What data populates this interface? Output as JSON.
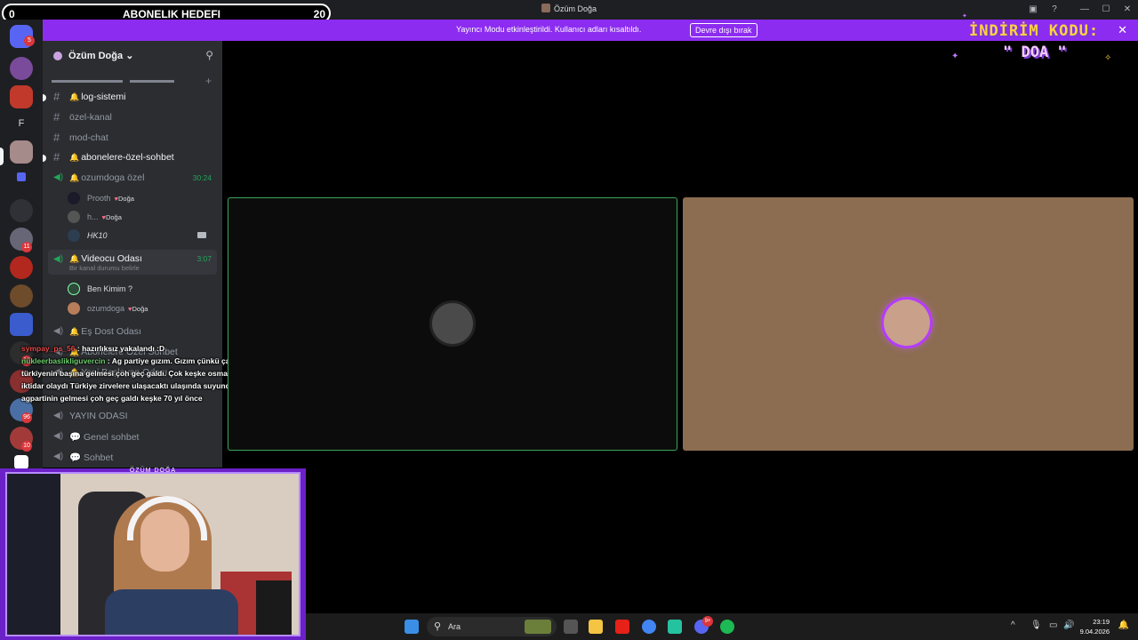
{
  "window": {
    "title": "Özüm Doğa",
    "controls": [
      "—",
      "☐",
      "✕"
    ]
  },
  "subscriber_goal": {
    "current": "0",
    "label": "ABONELIK HEDEFI",
    "target": "20"
  },
  "streamer_banner": {
    "message": "Yayıncı Modu etkinleştirildi. Kullanıcı adları kısaltıldı.",
    "button": "Devre dışı bırak",
    "close": "✕"
  },
  "server_rail": {
    "badges": [
      "5",
      "11",
      "17",
      "96",
      "10"
    ],
    "letter_server": "F"
  },
  "server": {
    "name": "Özüm Doğa",
    "chevron": "⌄",
    "invite_icon": "user-plus-icon"
  },
  "channels": [
    {
      "type": "text",
      "name": "log-sistemi",
      "bell": true
    },
    {
      "type": "text",
      "name": "özel-kanal",
      "bell": false
    },
    {
      "type": "text",
      "name": "mod-chat",
      "bell": false
    },
    {
      "type": "text",
      "name": "abonelere-özel-sohbet",
      "bell": true
    },
    {
      "type": "voice",
      "name": "ozumdoga özel",
      "bell": true,
      "time": "30:24"
    },
    {
      "type": "voice",
      "name": "Videocu Odası",
      "bell": true,
      "time": "3:07",
      "status": "Bir kanal durumu belirle"
    },
    {
      "type": "voice",
      "name": "Eş Dost Odası",
      "bell": true
    },
    {
      "type": "voice",
      "name": "Abonelere Özel Sohbet",
      "bell": true
    },
    {
      "type": "voice",
      "name": "Yeni Başlayan Odası",
      "bell": true
    },
    {
      "type": "voice",
      "name": "YAYIN ODASI",
      "bell": false
    },
    {
      "type": "voice",
      "name": "Genel sohbet",
      "bubble": true
    },
    {
      "type": "voice",
      "name": "Sohbet",
      "bubble": true
    }
  ],
  "voice_users": {
    "ozel": [
      {
        "name": "Prooth",
        "tag": "Doğa"
      },
      {
        "name": "h...",
        "tag": "Doğa"
      },
      {
        "name": "HK10",
        "tag": ""
      }
    ],
    "videocu": [
      {
        "name": "Ben Kimim ?",
        "tag": ""
      },
      {
        "name": "ozumdoga",
        "tag": "Doğa"
      }
    ]
  },
  "chat_overlay": [
    {
      "user": "sympay_ps_56",
      "text": ": hazırlıksız yakalandı :D"
    },
    {
      "user": "nükleerbaslikliguvercin",
      "text": ": Ag partiye gızım. Gızım çünkü çalişiya Bu akpartinin bu türkiyenin başına gelmesi çoh geç galdı. Çok keşke osmanlıdan soona bu iktidar gibi bir iktidar olaydı Türkiye zirvelere ulaşacaktı ulaşında suyunda düzenlemesinde bu agpartinin gelmesi çoh geç galdı keşke 70 yıl önce"
    }
  ],
  "discount": {
    "line1": "İNDİRİM KODU:",
    "line2": "\" DOA \""
  },
  "webcam": {
    "caption": "ÖZÜM DOĞA"
  },
  "taskbar": {
    "search": "Ara",
    "time": "23:19",
    "date": "9.04.2026",
    "discord_badge": "9+"
  },
  "colors": {
    "banner": "#8c2cf0",
    "speaking_outline": "#3ba55c",
    "discount_text": "#ffd23f"
  }
}
